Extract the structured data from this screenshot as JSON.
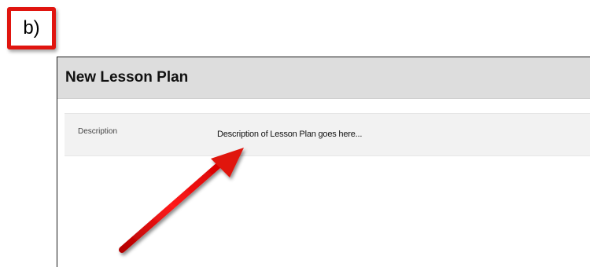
{
  "badge": {
    "label": "b)"
  },
  "panel": {
    "title": "New Lesson Plan",
    "description_field": {
      "label": "Description",
      "value": "Description of Lesson Plan goes here..."
    }
  },
  "colors": {
    "annotation_red": "#e0150f",
    "header_bg": "#dddddd",
    "row_bg": "#f2f2f2"
  },
  "icons": {
    "annotation_arrow": "arrow-pointer-icon"
  }
}
